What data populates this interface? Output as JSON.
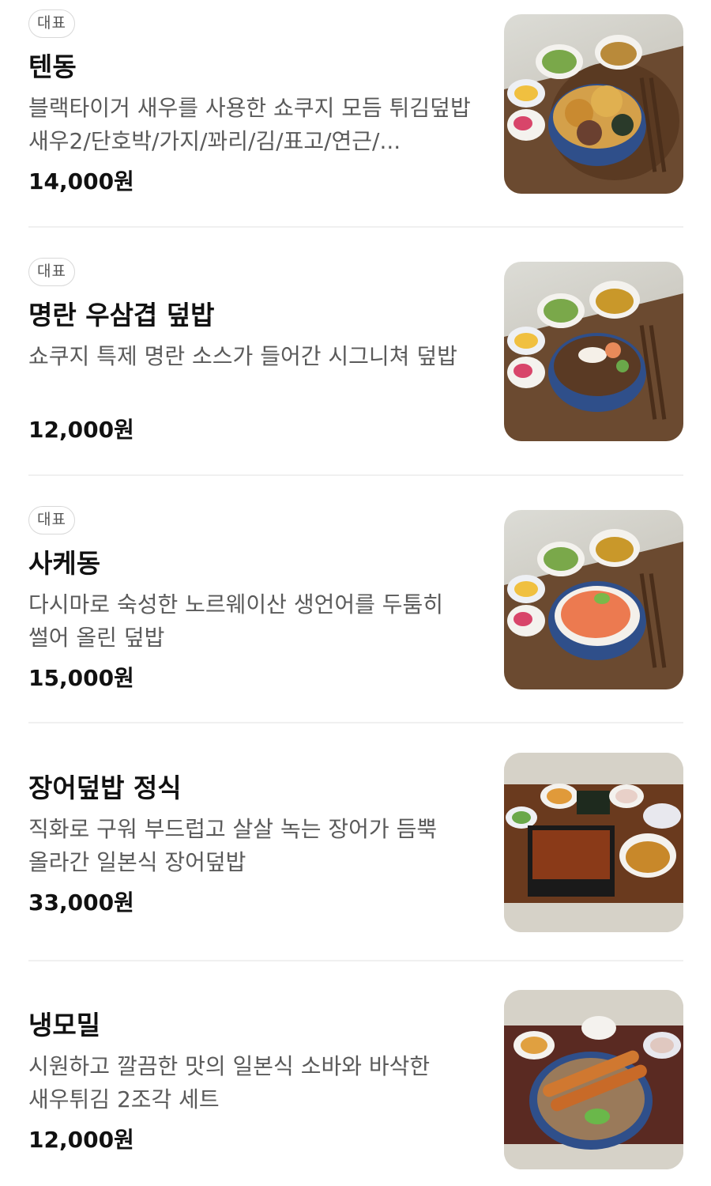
{
  "badge_label": "대표",
  "items": [
    {
      "name": "텐동",
      "description": "블랙타이거 새우를 사용한 쇼쿠지 모듬 튀김덮밥 새우2/단호박/가지/꽈리/김/표고/연근/...",
      "price": "14,000원",
      "image_icon": "tendon-dish-photo"
    },
    {
      "name": "명란 우삼겹 덮밥",
      "description": "쇼쿠지 특제 명란 소스가 들어간 시그니쳐 덮밥",
      "price": "12,000원",
      "image_icon": "mentaiko-beef-bowl-photo"
    },
    {
      "name": "사케동",
      "description": "다시마로 숙성한 노르웨이산 생언어를 두툼히 썰어 올린 덮밥",
      "price": "15,000원",
      "image_icon": "salmon-bowl-photo"
    },
    {
      "name": "장어덮밥 정식",
      "description": "직화로 구워 부드럽고 살살 녹는 장어가 듬뿍 올라간 일본식 장어덮밥",
      "price": "33,000원",
      "image_icon": "eel-rice-set-photo"
    },
    {
      "name": "냉모밀",
      "description": "시원하고 깔끔한 맛의 일본식 소바와 바삭한 새우튀김 2조각 세트",
      "price": "12,000원",
      "image_icon": "cold-soba-photo"
    }
  ]
}
